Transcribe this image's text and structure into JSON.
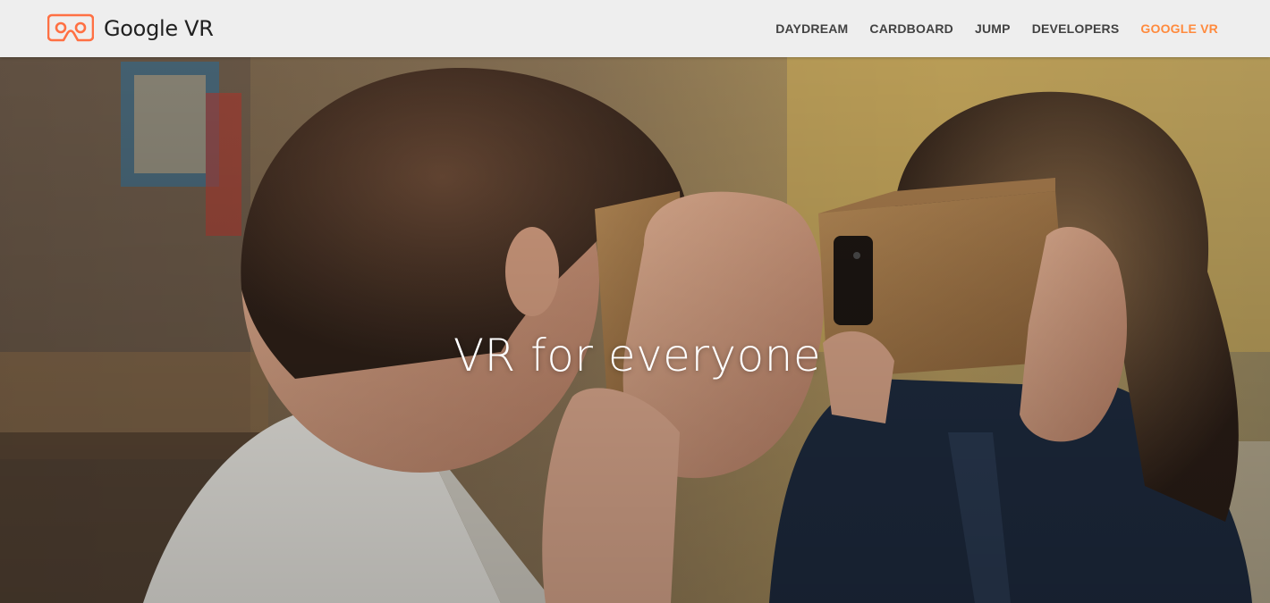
{
  "header": {
    "brand_name": "Google VR",
    "nav": [
      {
        "label": "DAYDREAM",
        "active": false
      },
      {
        "label": "CARDBOARD",
        "active": false
      },
      {
        "label": "JUMP",
        "active": false
      },
      {
        "label": "DEVELOPERS",
        "active": false
      },
      {
        "label": "GOOGLE VR",
        "active": true
      }
    ]
  },
  "hero": {
    "title": "VR for everyone"
  },
  "colors": {
    "header_bg": "#eeeeee",
    "nav_text": "#424242",
    "nav_active": "#ff8a3d",
    "logo_accent": "#ff7043"
  }
}
